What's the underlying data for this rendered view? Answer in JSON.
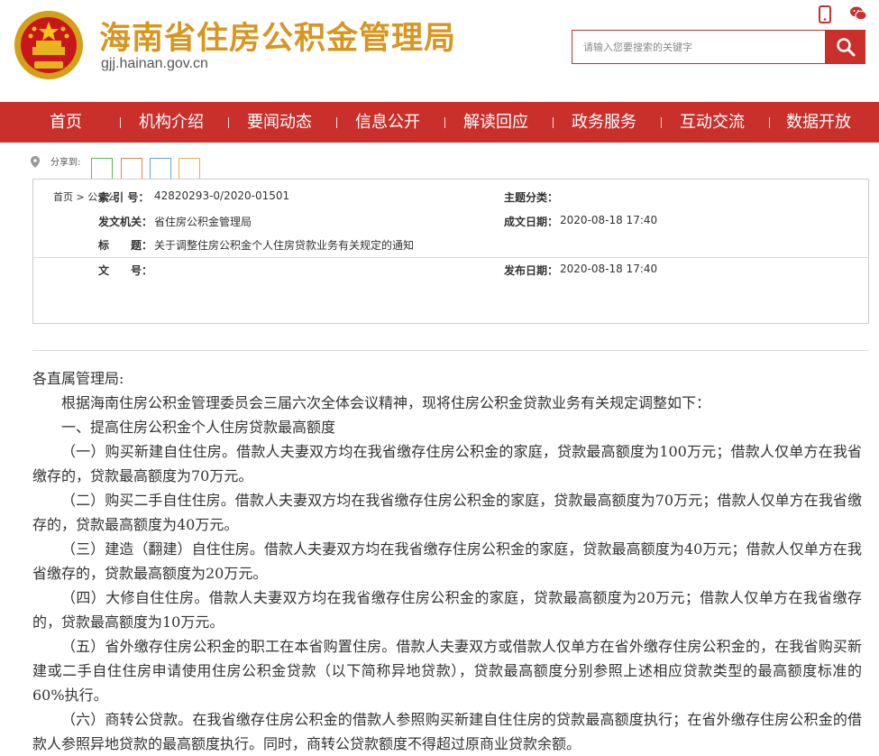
{
  "header": {
    "site_title": "海南省住房公积金管理局",
    "site_domain": "gjj.hainan.gov.cn",
    "search_placeholder": "请输入您要搜索的关键字"
  },
  "nav": {
    "items": [
      "首页",
      "机构介绍",
      "要闻动态",
      "信息公开",
      "解读回应",
      "政务服务",
      "互动交流",
      "数据开放"
    ]
  },
  "breadcrumb": {
    "share_label": "分享到:",
    "path": "首页 > 公众公",
    "share_colors": [
      "#5cb85c",
      "#e67e50",
      "#5ba8d8",
      "#e8b04a"
    ]
  },
  "metadata": {
    "index_no_label": "索 引 号：",
    "index_no": "42820293-0/2020-01501",
    "topic_label": "主题分类：",
    "topic": "",
    "issuer_label": "发文机关：",
    "issuer": "省住房公积金管理局",
    "created_label": "成文日期：",
    "created": "2020-08-18 17:40",
    "title_label": "标　　题：",
    "title": "关于调整住房公积金个人住房贷款业务有关规定的通知",
    "doc_no_label": "文　　号：",
    "doc_no": "",
    "published_label": "发布日期：",
    "published": "2020-08-18 17:40"
  },
  "article": {
    "salutation": "各直属管理局:",
    "intro": "根据海南住房公积金管理委员会三届六次全体会议精神，现将住房公积金贷款业务有关规定调整如下：",
    "section_1": "一、提高住房公积金个人住房贷款最高额度",
    "items": [
      "（一）购买新建自住住房。借款人夫妻双方均在我省缴存住房公积金的家庭，贷款最高额度为100万元；借款人仅单方在我省缴存的，贷款最高额度为70万元。",
      "（二）购买二手自住住房。借款人夫妻双方均在我省缴存住房公积金的家庭，贷款最高额度为70万元；借款人仅单方在我省缴存的，贷款最高额度为40万元。",
      "（三）建造（翻建）自住住房。借款人夫妻双方均在我省缴存住房公积金的家庭，贷款最高额度为40万元；借款人仅单方在我省缴存的，贷款最高额度为20万元。",
      "（四）大修自住住房。借款人夫妻双方均在我省缴存住房公积金的家庭，贷款最高额度为20万元；借款人仅单方在我省缴存的，贷款最高额度为10万元。",
      "（五）省外缴存住房公积金的职工在本省购置住房。借款人夫妻双方或借款人仅单方在省外缴存住房公积金的，在我省购买新建或二手自住住房申请使用住房公积金贷款（以下简称异地贷款），贷款最高额度分别参照上述相应贷款类型的最高额度标准的60%执行。",
      "（六）商转公贷款。在我省缴存住房公积金的借款人参照购买新建自住住房的贷款最高额度执行；在省外缴存住房公积金的借款人参照异地贷款的最高额度执行。同时，商转公贷款额度不得超过原商业贷款余额。"
    ]
  }
}
